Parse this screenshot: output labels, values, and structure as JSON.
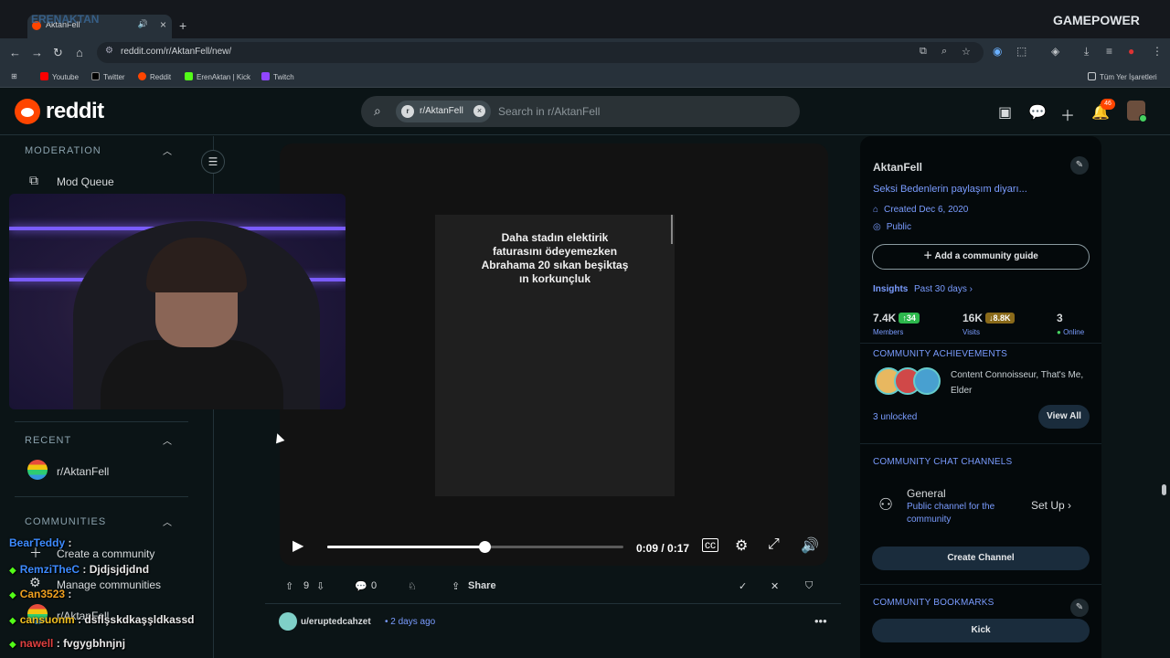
{
  "browser": {
    "tab_title": "AktanFell",
    "url": "reddit.com/r/AktanFell/new/",
    "bookmarks": [
      "Youtube",
      "Twitter",
      "Reddit",
      "ErenAktan | Kick",
      "Twitch"
    ],
    "all_bookmarks_label": "Tüm Yer İşaretleri",
    "watermark_left": "ERENAKTAN",
    "watermark_right": "GAMEPOWER"
  },
  "header": {
    "logo_text": "reddit",
    "search_chip": "r/AktanFell",
    "search_placeholder": "Search in r/AktanFell",
    "notification_count": "46"
  },
  "leftnav": {
    "moderation_title": "MODERATION",
    "mod_queue": "Mod Queue",
    "recent_title": "RECENT",
    "recent_item": "r/AktanFell",
    "communities_title": "COMMUNITIES",
    "create_community": "Create a community",
    "manage_communities": "Manage communities",
    "community_item": "r/AktanFell"
  },
  "chat": [
    {
      "user": "BearTeddy",
      "msg": ":",
      "color": "#3d8bff"
    },
    {
      "user": "RemziTheC",
      "msg": ": Djdjsjdjdnd",
      "color": "#3d8bff"
    },
    {
      "user": "Can3523",
      "msg": ":",
      "color": "#f0a020"
    },
    {
      "user": "cansuonm",
      "msg": ": dsflşskdkaşşldkassd",
      "color": "#f0c020"
    },
    {
      "user": "nawell",
      "msg": ": fvgygbhnjnj",
      "color": "#e04040"
    }
  ],
  "player": {
    "caption_lines": [
      "Daha stadın elektirik",
      "faturasını ödeyemezken",
      "Abrahama 20 sıkan beşiktaş",
      "ın korkunçluk"
    ],
    "current_time": "0:09",
    "duration": "0:17",
    "progress_fraction": 0.53
  },
  "post_actions": {
    "votes": "9",
    "comments": "0",
    "share": "Share"
  },
  "next_post": {
    "user": "u/eruptedcahzet",
    "time": "2 days ago"
  },
  "sidebar": {
    "name": "AktanFell",
    "description": "Seksi Bedenlerin paylaşım diyarı...",
    "created": "Created Dec 6, 2020",
    "visibility": "Public",
    "guide_button": "Add a community guide",
    "insights_label": "Insights",
    "insights_period": "Past 30 days ›",
    "members_value": "7.4K",
    "members_delta": "↑34",
    "members_label": "Members",
    "visits_value": "16K",
    "visits_delta": "↓8.8K",
    "visits_label": "Visits",
    "online_value": "3",
    "online_label": "Online",
    "achievements_title": "COMMUNITY ACHIEVEMENTS",
    "achievements_text_1": "Content Connoisseur, That's Me,",
    "achievements_text_2": "Elder",
    "unlocked": "3 unlocked",
    "view_all": "View All",
    "chat_title": "COMMUNITY CHAT CHANNELS",
    "channel_name": "General",
    "channel_desc_1": "Public channel for the",
    "channel_desc_2": "community",
    "setup": "Set Up",
    "create_channel": "Create Channel",
    "bookmarks_title": "COMMUNITY BOOKMARKS",
    "bookmark_1": "Kick"
  },
  "colors": {
    "accent_orange": "#ff4500",
    "link_blue": "#7a9cff",
    "up_green": "#2db84d",
    "down_brown": "#8a6a1a",
    "online_green": "#46d160"
  }
}
